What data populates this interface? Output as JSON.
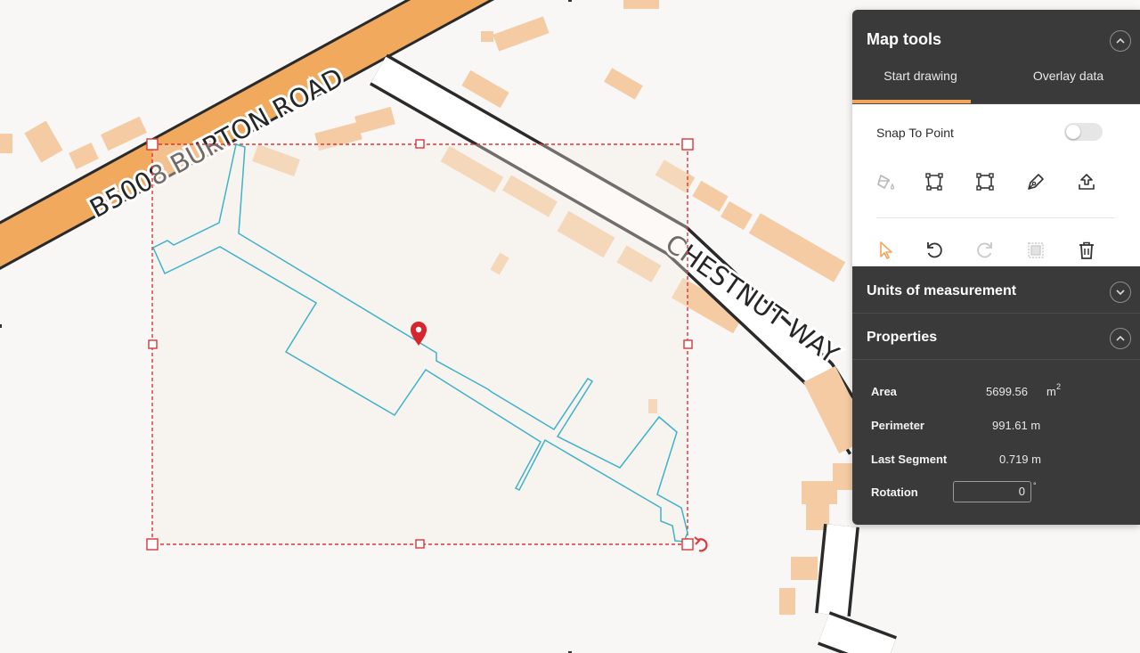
{
  "map": {
    "road_labels": {
      "burton_road": "B5008   BURTON ROAD",
      "chestnut_way": "CHESTNUT WAY"
    }
  },
  "panel": {
    "title": "Map tools",
    "tabs": [
      {
        "label": "Start drawing",
        "active": true
      },
      {
        "label": "Overlay data",
        "active": false
      }
    ],
    "snap_label": "Snap To Point",
    "snap_enabled": false,
    "tools_row1": [
      "paint-bucket-icon",
      "polygon-select-icon",
      "rectangle-select-icon",
      "pen-icon",
      "upload-icon"
    ],
    "tools_row2": [
      "pointer-icon",
      "undo-icon",
      "redo-icon",
      "fit-extent-icon",
      "trash-icon"
    ],
    "units_title": "Units of measurement",
    "properties_title": "Properties",
    "properties": {
      "area_label": "Area",
      "area_value": "5699.56",
      "area_unit": "m",
      "area_unit_exp": "2",
      "perimeter_label": "Perimeter",
      "perimeter_value": "991.61 m",
      "segment_label": "Last Segment",
      "segment_value": "0.719 m",
      "rotation_label": "Rotation",
      "rotation_value": "0",
      "rotation_unit": "°"
    }
  },
  "colors": {
    "accent": "#f2a65a",
    "panel_bg": "#3a3a3a",
    "selection": "#d9373a",
    "outline": "#3fb1c9",
    "main_road": "#f1a95e"
  }
}
